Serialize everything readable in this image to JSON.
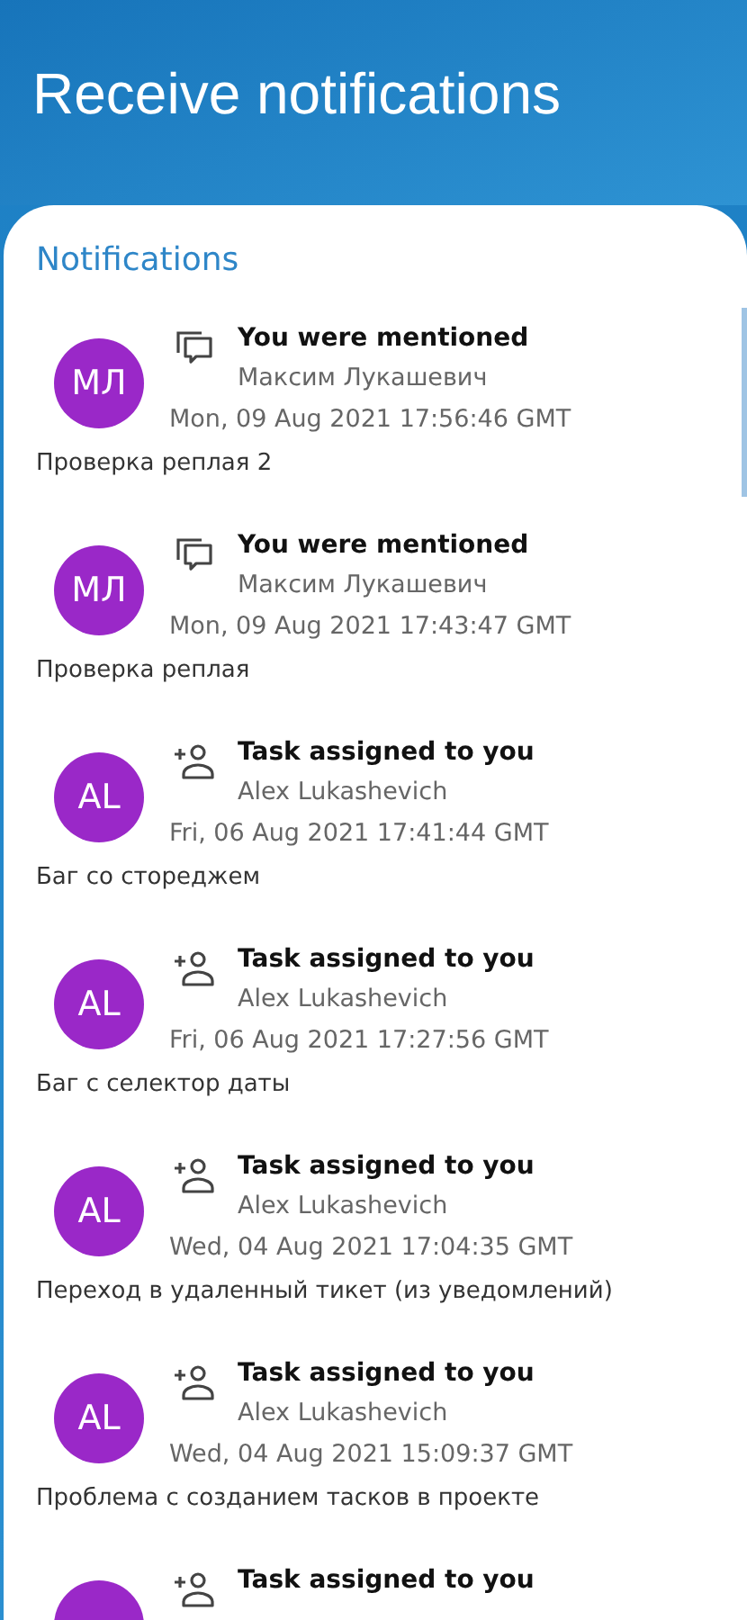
{
  "header": {
    "title": "Receive notifications"
  },
  "section_title": "Notifications",
  "notifications": [
    {
      "kind": "mention",
      "initials": "МЛ",
      "title": "You were mentioned",
      "author": "Максим Лукашевич",
      "date": "Mon, 09 Aug 2021 17:56:46 GMT",
      "message": "Проверка реплая 2"
    },
    {
      "kind": "mention",
      "initials": "МЛ",
      "title": "You were mentioned",
      "author": "Максим Лукашевич",
      "date": "Mon, 09 Aug 2021 17:43:47 GMT",
      "message": "Проверка реплая"
    },
    {
      "kind": "task",
      "initials": "AL",
      "title": "Task assigned to you",
      "author": "Alex Lukashevich",
      "date": "Fri, 06 Aug 2021 17:41:44 GMT",
      "message": "Баг со стореджем"
    },
    {
      "kind": "task",
      "initials": "AL",
      "title": "Task assigned to you",
      "author": "Alex Lukashevich",
      "date": "Fri, 06 Aug 2021 17:27:56 GMT",
      "message": "Баг с селектор даты"
    },
    {
      "kind": "task",
      "initials": "AL",
      "title": "Task assigned to you",
      "author": "Alex Lukashevich",
      "date": "Wed, 04 Aug 2021 17:04:35 GMT",
      "message": "Переход в удаленный тикет (из уведомлений)"
    },
    {
      "kind": "task",
      "initials": "AL",
      "title": "Task assigned to you",
      "author": "Alex Lukashevich",
      "date": "Wed, 04 Aug 2021 15:09:37 GMT",
      "message": "Проблема с созданием тасков в проекте"
    },
    {
      "kind": "task",
      "title": "Task assigned to you"
    }
  ]
}
